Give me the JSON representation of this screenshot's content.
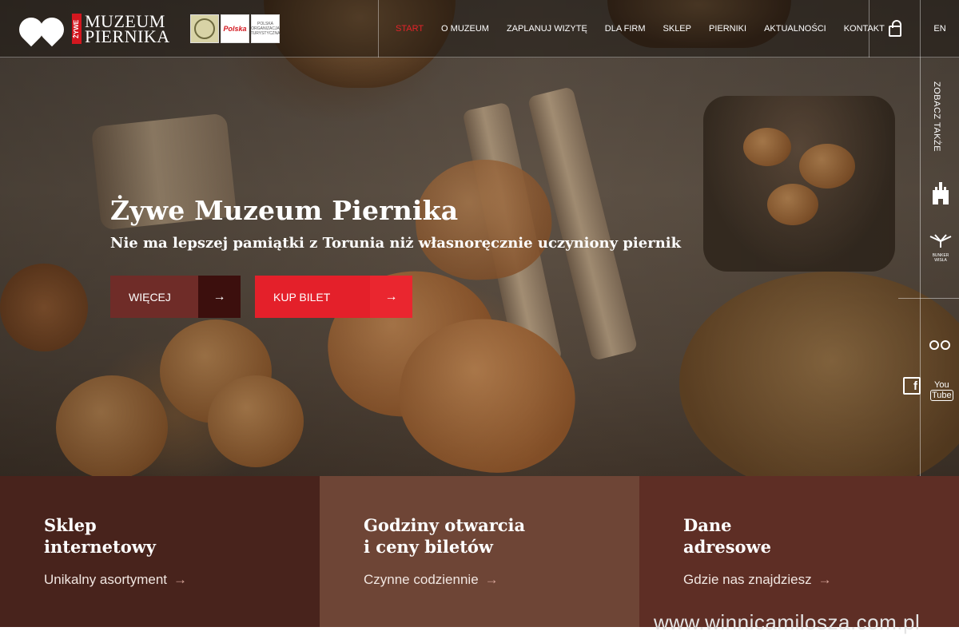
{
  "header": {
    "logo": {
      "tag": "ŻYWE",
      "line1": "MUZEUM",
      "line2": "PIERNIKA"
    },
    "partners": [
      {
        "icon": "certificate-badge-icon"
      },
      {
        "label": "Polska"
      },
      {
        "label": "POLSKA ORGANIZACJA TURYSTYCZNA"
      }
    ],
    "nav": [
      "START",
      "O MUZEUM",
      "ZAPLANUJ WIZYTĘ",
      "DLA FIRM",
      "SKLEP",
      "PIERNIKI",
      "AKTUALNOŚCI",
      "KONTAKT"
    ],
    "active_nav": "START",
    "cart_icon": "shopping-bag-icon",
    "lang": "EN"
  },
  "side": {
    "label": "ZOBACZ TAKŻE",
    "bunker_label": "BUNKER WISŁA",
    "icons": [
      "castle-icon",
      "bunker-wisla-icon",
      "tripadvisor-icon",
      "facebook-icon",
      "youtube-icon"
    ],
    "youtube_text_1": "You",
    "youtube_text_2": "Tube",
    "facebook_text": "f"
  },
  "hero": {
    "title": "Żywe Muzeum Piernika",
    "subtitle": "Nie ma lepszej pamiątki z Torunia niż własnoręcznie uczyniony piernik",
    "more_label": "WIĘCEJ",
    "ticket_label": "KUP BILET",
    "arrow": "→"
  },
  "tiles": [
    {
      "title_1": "Sklep",
      "title_2": "internetowy",
      "link": "Unikalny asortyment",
      "arrow": "→"
    },
    {
      "title_1": "Godziny otwarcia",
      "title_2": "i ceny biletów",
      "link": "Czynne codziennie",
      "arrow": "→"
    },
    {
      "title_1": "Dane",
      "title_2": "adresowe",
      "link": "Gdzie nas znajdziesz",
      "arrow": "→"
    }
  ],
  "watermark": "www.winnicamilosza.com.pl",
  "colors": {
    "accent_red": "#e4202a",
    "dark_brown": "#48231c",
    "mid_brown": "#6e4536",
    "red_brown": "#5e2e25",
    "more_button": "#6f2c28"
  }
}
